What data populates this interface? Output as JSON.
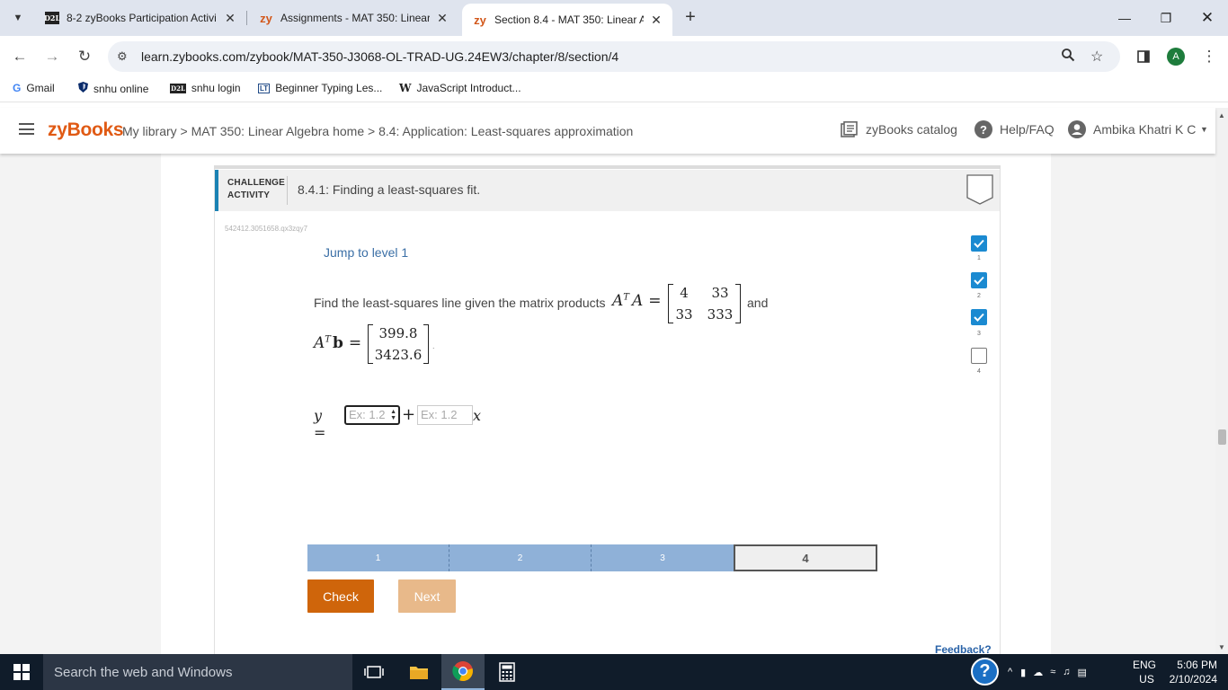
{
  "browser": {
    "tabs": [
      {
        "favicon": "D2L",
        "title": "8-2 zyBooks Participation Activi",
        "active": false
      },
      {
        "favicon": "zy",
        "title": "Assignments - MAT 350: Linear",
        "active": false
      },
      {
        "favicon": "zy",
        "title": "Section 8.4 - MAT 350: Linear A",
        "active": true
      }
    ],
    "url": "learn.zybooks.com/zybook/MAT-350-J3068-OL-TRAD-UG.24EW3/chapter/8/section/4",
    "profile_initial": "A",
    "bookmarks": [
      {
        "icon": "G",
        "label": "Gmail"
      },
      {
        "icon": "shield",
        "label": "snhu online"
      },
      {
        "icon": "D2L",
        "label": "snhu login"
      },
      {
        "icon": "LT",
        "label": "Beginner Typing Les..."
      },
      {
        "icon": "W",
        "label": "JavaScript Introduct..."
      }
    ]
  },
  "zybooks": {
    "logo": "zyBooks",
    "breadcrumb": "My library > MAT 350: Linear Algebra home > 8.4: Application: Least-squares approximation",
    "catalog_label": "zyBooks catalog",
    "help_label": "Help/FAQ",
    "user_name": "Ambika Khatri K C"
  },
  "activity": {
    "type_line1": "CHALLENGE",
    "type_line2": "ACTIVITY",
    "title": "8.4.1: Finding a least-squares fit.",
    "id_text": "542412.3051658.qx3zqy7",
    "jump_label": "Jump to level 1",
    "prompt_prefix": "Find the least-squares line given the matrix products",
    "prompt_and": "and",
    "ata_matrix": [
      [
        "4",
        "33"
      ],
      [
        "33",
        "333"
      ]
    ],
    "atb_vector": [
      "399.8",
      "3423.6"
    ],
    "answer": {
      "y_label": "y =",
      "plus": "+",
      "x_label": "x",
      "intercept_placeholder": "Ex: 1.2",
      "slope_placeholder": "Ex: 1.2"
    },
    "levels": [
      "1",
      "2",
      "3",
      "4"
    ],
    "current_level": "4",
    "check_label": "Check",
    "next_label": "Next",
    "feedback_label": "Feedback?",
    "side_levels": [
      {
        "num": "1",
        "done": true
      },
      {
        "num": "2",
        "done": true
      },
      {
        "num": "3",
        "done": true
      },
      {
        "num": "4",
        "done": false
      }
    ]
  },
  "taskbar": {
    "search_placeholder": "Search the web and Windows",
    "lang_top": "ENG",
    "lang_bottom": "US",
    "time": "5:06 PM",
    "date": "2/10/2024"
  },
  "colors": {
    "zybooks_orange": "#e05a14",
    "activity_accent": "#1b82b4",
    "check_button": "#cf650b",
    "level_done": "#8fb1d8",
    "side_done": "#1b8ad1"
  }
}
